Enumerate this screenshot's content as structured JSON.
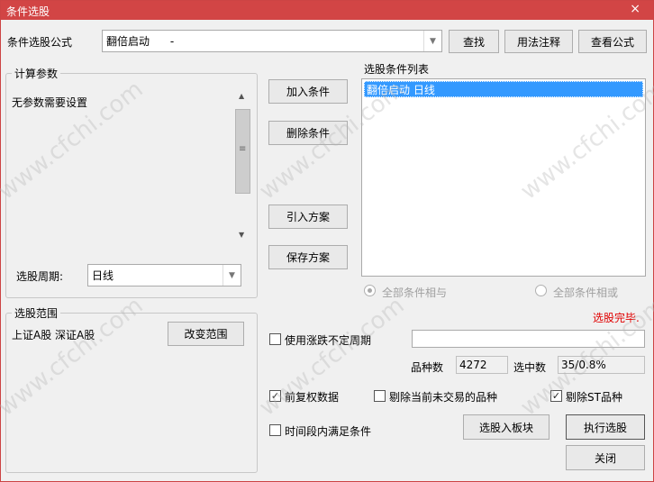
{
  "window": {
    "title": "条件选股",
    "close_glyph": "×"
  },
  "formula": {
    "label": "条件选股公式",
    "value": "翻倍启动      -",
    "find_label": "查找",
    "usage_label": "用法注释",
    "view_label": "查看公式"
  },
  "params": {
    "group_label": "计算参数",
    "text": "无参数需要设置",
    "period_label": "选股周期:",
    "period_value": "日线"
  },
  "actions": {
    "add_condition": "加入条件",
    "delete_condition": "删除条件",
    "import_scheme": "引入方案",
    "save_scheme": "保存方案"
  },
  "conditions": {
    "list_label": "选股条件列表",
    "items": [
      "翻倍启动  日线"
    ],
    "and_label": "全部条件相与",
    "or_label": "全部条件相或",
    "status": "选股完毕."
  },
  "scope": {
    "group_label": "选股范围",
    "value": "上证A股 深证A股",
    "change_label": "改变范围"
  },
  "options": {
    "variable_period_label": "使用涨跌不定周期",
    "variable_period_value": "",
    "count_label": "品种数",
    "count_value": "4272",
    "selected_label": "选中数",
    "selected_value": "35/0.8%",
    "adjust_label": "前复权数据",
    "exclude_untraded_label": "剔除当前未交易的品种",
    "exclude_st_label": "剔除ST品种",
    "time_range_label": "时间段内满足条件",
    "check_glyph": "✓"
  },
  "buttons": {
    "to_block": "选股入板块",
    "execute": "执行选股",
    "close": "关闭"
  },
  "watermark": "www.cfchi.com",
  "colors": {
    "title_bg": "#d24545",
    "selection": "#3399ff",
    "status": "#e00000"
  }
}
